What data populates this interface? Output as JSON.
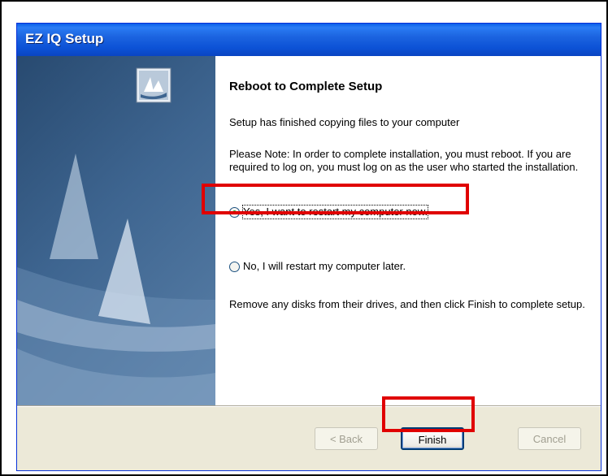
{
  "window": {
    "title": "EZ IQ Setup"
  },
  "content": {
    "heading": "Reboot to Complete Setup",
    "line1": "Setup has finished copying files to your computer",
    "note": "Please Note:  In order to complete installation, you must reboot. If you are required to log on, you must log on as the user who started the installation.",
    "option_yes": "Yes, I want to restart my computer now.",
    "option_no": "No, I will restart my computer later.",
    "selected_option": "option_yes",
    "remove_disks": "Remove any disks from their drives, and then click Finish to complete setup."
  },
  "buttons": {
    "back": "< Back",
    "finish": "Finish",
    "cancel": "Cancel",
    "back_enabled": false,
    "cancel_enabled": false
  },
  "icons": {
    "banner_logo": "setup-logo-icon"
  },
  "colors": {
    "titlebar": "#0c52d6",
    "banner": "#3e6590",
    "highlight": "#e00000",
    "radio_dot": "#21a121"
  }
}
